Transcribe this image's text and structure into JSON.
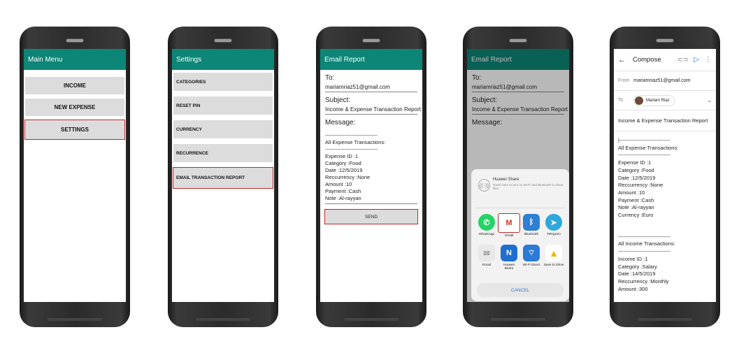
{
  "screens": {
    "main_menu": {
      "title": "Main Menu",
      "buttons": [
        "INCOME",
        "NEW EXPENSE",
        "SETTINGS"
      ]
    },
    "settings": {
      "title": "Settings",
      "items": [
        "CATEGORIES",
        "RESET PIN",
        "CURRENCY",
        "RECURRENCE",
        "EMAIL TRANSACTION REPORT"
      ]
    },
    "email_report": {
      "title": "Email Report",
      "to_label": "To:",
      "to_value": "mariamriaz51@gmail.com",
      "subject_label": "Subject:",
      "subject_value": "Income & Expense Transaction Report",
      "message_label": "Message:",
      "message_lines": [
        "------------------------------",
        "All Expense Transactions:",
        "------------------------------",
        "Expense ID :1",
        "Category :Food",
        "Date :12/5/2019",
        "Reccurrency :None",
        "Amount :10",
        "Payment :Cash",
        "Note :Al-rayyan"
      ],
      "send_label": "SEND"
    },
    "share": {
      "title": "Email Report",
      "to_label": "To:",
      "to_value": "mariamriaz51@gmail.com",
      "subject_label": "Subject:",
      "subject_value": "Income & Expense Transaction Report",
      "message_label": "Message:",
      "huawei_share_title": "Huawei Share",
      "huawei_share_sub": "Touch here to turn on Wi-Fi and Bluetooth to share files.",
      "apps": [
        {
          "label": "WhatsApp",
          "icon": "whatsapp-icon",
          "color": "#25d366",
          "glyph": "✆"
        },
        {
          "label": "Gmail",
          "icon": "gmail-icon",
          "color": "#ffffff",
          "glyph": "M"
        },
        {
          "label": "Bluetooth",
          "icon": "bluetooth-icon",
          "color": "#2f7fd3",
          "glyph": "ᛒ"
        },
        {
          "label": "Telegram",
          "icon": "telegram-icon",
          "color": "#2ea6de",
          "glyph": "➤"
        },
        {
          "label": "Email",
          "icon": "email-icon",
          "color": "#e8e8e8",
          "glyph": "✉"
        },
        {
          "label": "Huawei\nBeam",
          "icon": "nfc-icon",
          "color": "#1f6fd0",
          "glyph": "N"
        },
        {
          "label": "Wi-Fi Direct",
          "icon": "wifi-direct-icon",
          "color": "#2a7ad6",
          "glyph": "⌔"
        },
        {
          "label": "Save to Drive",
          "icon": "drive-icon",
          "color": "#ffffff",
          "glyph": "▲"
        }
      ],
      "cancel_label": "CANCEL"
    },
    "compose": {
      "title": "Compose",
      "from_label": "From",
      "from_value": "mariamriaz51@gmail.com",
      "to_label": "To",
      "to_chip": "Mariam Riaz",
      "subject": "Income & Expense Transaction Report",
      "body_lines": [
        "|-----------------------------",
        "All Expense Transactions:",
        "------------------------------",
        "Expense ID :1",
        "Category :Food",
        "Date :12/5/2019",
        "Reccurrency :None",
        "Amount :10",
        "Payment :Cash",
        "Note :Al-rayyan",
        "Currency :Euro",
        "",
        "",
        "------------------------------",
        "All Income Transactions:",
        "------------------------------",
        "Income ID :1",
        "Category :Salary",
        "Date :14/5/2019",
        "Reccurrency :Monthly",
        "Amount :300"
      ]
    }
  },
  "colors": {
    "appbar": "#0d8577",
    "highlight": "#c0282c"
  }
}
